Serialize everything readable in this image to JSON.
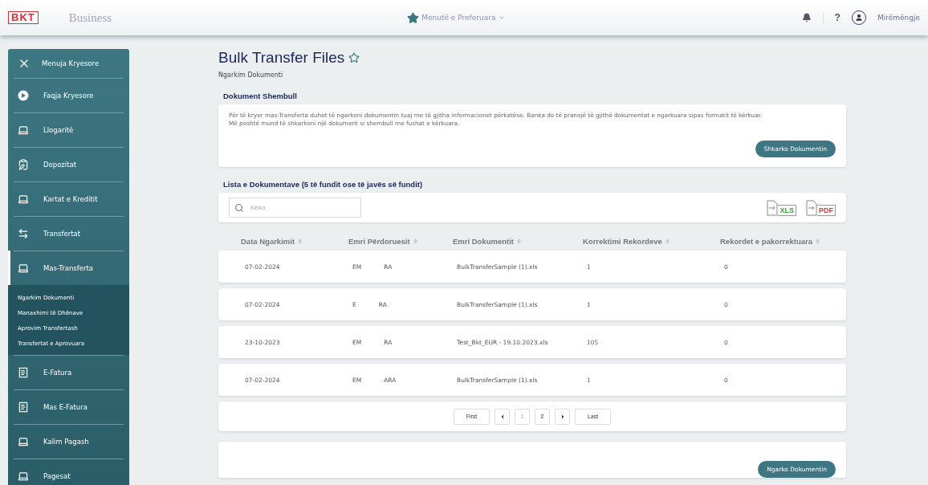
{
  "topbar": {
    "brand": "BKT",
    "product": "Business",
    "favorites": "Menutë e Preferuara",
    "help": "?",
    "greeting": "Mirëmëngje"
  },
  "sidebar": {
    "close_label": "Menuja Kryesore",
    "items": [
      {
        "label": "Faqja Kryesore",
        "kind": "home",
        "selected": false
      },
      {
        "label": "Llogaritë",
        "kind": "laptop",
        "selected": false
      },
      {
        "label": "Depozitat",
        "kind": "clipboard",
        "selected": false
      },
      {
        "label": "Kartat e Kreditit",
        "kind": "laptop",
        "selected": false
      },
      {
        "label": "Transfertat",
        "kind": "transfer",
        "selected": false
      },
      {
        "label": "Mas-Transferta",
        "kind": "laptop",
        "selected": true,
        "expanded": true,
        "children": [
          {
            "label": "Ngarkim Dokumenti"
          },
          {
            "label": "Manaxhimi të Dhënave"
          },
          {
            "label": "Aprovim Transfertash"
          },
          {
            "label": "Transfertat e Aprovuara"
          }
        ]
      },
      {
        "label": "E-Fatura",
        "kind": "invoice",
        "selected": false
      },
      {
        "label": "Mas E-Fatura",
        "kind": "invoice",
        "selected": false
      },
      {
        "label": "Kalim Pagash",
        "kind": "laptop",
        "selected": false
      },
      {
        "label": "Pagesat",
        "kind": "laptop",
        "selected": false
      }
    ]
  },
  "page": {
    "title": "Bulk Transfer Files",
    "subtitle": "Ngarkim Dokumenti"
  },
  "sample": {
    "heading": "Dokument Shembull",
    "text": "Për të kryer mas-Transferta duhet të ngarkoni dokumentin tuaj me të gjitha informacionet përkatëse. Banka do të pranojë të gjithë dokumentat e ngarkuara sipas formatit të kërkuar.",
    "text_2": "Më poshtë mund të shkarkoni një dokument si shembull me fushat e kërkuara.",
    "button": "Shkarko Dokumentin"
  },
  "list": {
    "heading": "Lista e Dokumentave (5 të fundit ose të javës së fundit)",
    "search": {
      "placeholder": "Kërko"
    },
    "exports": [
      {
        "label": "XLS",
        "color": "#3aa03a"
      },
      {
        "label": "PDF",
        "color": "#d83a3a"
      }
    ]
  },
  "table": {
    "columns": [
      "Data Ngarkimit",
      "Emri Përdoruesit",
      "Emri Dokumentit",
      "Korrektimi Rekordeve",
      "Rekordet e pakorrektuara"
    ],
    "rows": [
      {
        "date": "07-02-2024",
        "user_start": "EM",
        "user_end": "RA",
        "document": "BulkTransferSample (1).xls",
        "corrected": "1",
        "uncorrected": "0"
      },
      {
        "date": "07-02-2024",
        "user_start": "E",
        "user_end": "RA",
        "document": "BulkTransferSample (1).xls",
        "corrected": "1",
        "uncorrected": "0"
      },
      {
        "date": "23-10-2023",
        "user_start": "EM",
        "user_end": "RA",
        "document": "Test_Bkt_EUR - 19.10.2023.xls",
        "corrected": "105",
        "uncorrected": "0"
      },
      {
        "date": "07-02-2024",
        "user_start": "EM",
        "user_end": "ARA",
        "document": "BulkTransferSample (1).xls",
        "corrected": "1",
        "uncorrected": "0"
      }
    ]
  },
  "pagination": {
    "first": "First",
    "last": "Last",
    "pages": [
      {
        "label": "1",
        "selected": true
      },
      {
        "label": "2",
        "selected": false
      }
    ]
  },
  "upload": {
    "button": "Ngarko Dokumentin"
  }
}
